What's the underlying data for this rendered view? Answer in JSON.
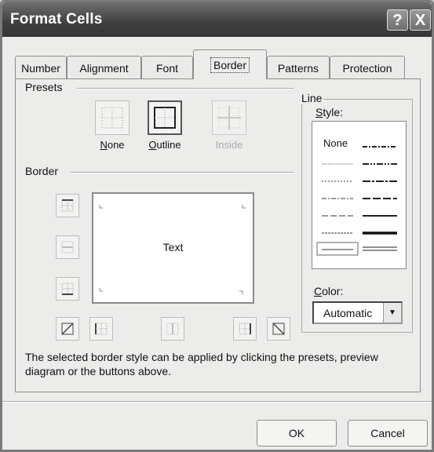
{
  "window": {
    "title": "Format Cells",
    "help_button": "?",
    "close_button": "X"
  },
  "tabs": [
    {
      "label": "Number",
      "active": false
    },
    {
      "label": "Alignment",
      "active": false
    },
    {
      "label": "Font",
      "active": false
    },
    {
      "label": "Border",
      "active": true
    },
    {
      "label": "Patterns",
      "active": false
    },
    {
      "label": "Protection",
      "active": false
    }
  ],
  "presets": {
    "group_label": "Presets",
    "items": [
      {
        "label": "None",
        "mnemonic": "N",
        "label_rest": "one",
        "enabled": true
      },
      {
        "label": "Outline",
        "mnemonic": "O",
        "label_rest": "utline",
        "enabled": true
      },
      {
        "label": "Inside",
        "mnemonic": "",
        "label_rest": "Inside",
        "enabled": false
      }
    ]
  },
  "border": {
    "group_label": "Border",
    "preview_text": "Text"
  },
  "line": {
    "group_label": "Line",
    "style_label_mnemonic": "S",
    "style_label_rest": "tyle:",
    "style_none": "None",
    "color_label_mnemonic": "C",
    "color_label_rest": "olor:",
    "color_value": "Automatic"
  },
  "description": "The selected border style can be applied by clicking the presets, preview diagram or the buttons above.",
  "buttons": {
    "ok": "OK",
    "cancel": "Cancel"
  }
}
